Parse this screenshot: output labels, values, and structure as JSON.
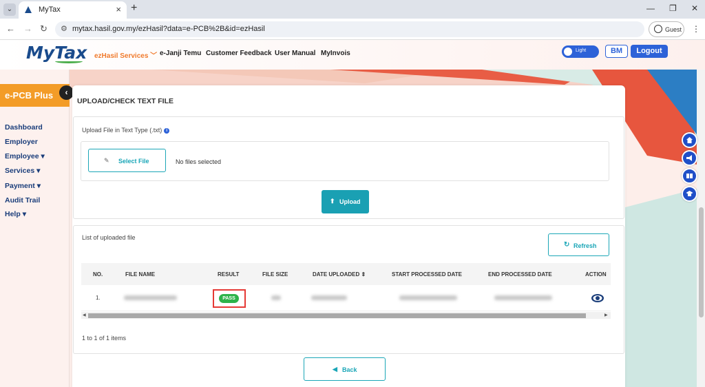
{
  "browser": {
    "tab_title": "MyTax",
    "url": "mytax.hasil.gov.my/ezHasil?data=e-PCB%2B&id=ezHasil",
    "guest_label": "Guest",
    "tab_menu_icon": "chevron-down-icon",
    "new_tab_icon": "plus-icon"
  },
  "header": {
    "logo": "MyTax",
    "nav": [
      {
        "label": "ezHasil Services",
        "active": true
      },
      {
        "label": "e-Janji Temu"
      },
      {
        "label": "Customer Feedback"
      },
      {
        "label": "User Manual"
      },
      {
        "label": "MyInvois"
      }
    ],
    "theme_toggle_label": "Light",
    "lang_button": "BM",
    "logout_button": "Logout"
  },
  "sidebar": {
    "title": "e-PCB Plus",
    "items": [
      "Dashboard",
      "Employer",
      "Employee",
      "Services",
      "Payment",
      "Audit Trail",
      "Help"
    ]
  },
  "main": {
    "title": "UPLOAD/CHECK TEXT FILE",
    "upload": {
      "label": "Upload File in Text Type (.txt)",
      "select_button": "Select File",
      "file_status": "No files selected",
      "upload_button": "Upload"
    },
    "list": {
      "label": "List of uploaded file",
      "refresh_button": "Refresh",
      "columns": [
        "NO.",
        "FILE NAME",
        "RESULT",
        "FILE SIZE",
        "DATE UPLOADED",
        "START PROCESSED DATE",
        "END PROCESSED DATE",
        "ACTION"
      ],
      "rows": [
        {
          "no": "1.",
          "result": "PASS"
        }
      ],
      "count_text": "1 to 1 of 1 items"
    },
    "back_button": "Back"
  },
  "colors": {
    "accent_blue": "#2d62d8",
    "teal": "#1aa0b3",
    "orange": "#f39c27",
    "pass_green": "#2db34a",
    "highlight_red": "#e53935"
  }
}
